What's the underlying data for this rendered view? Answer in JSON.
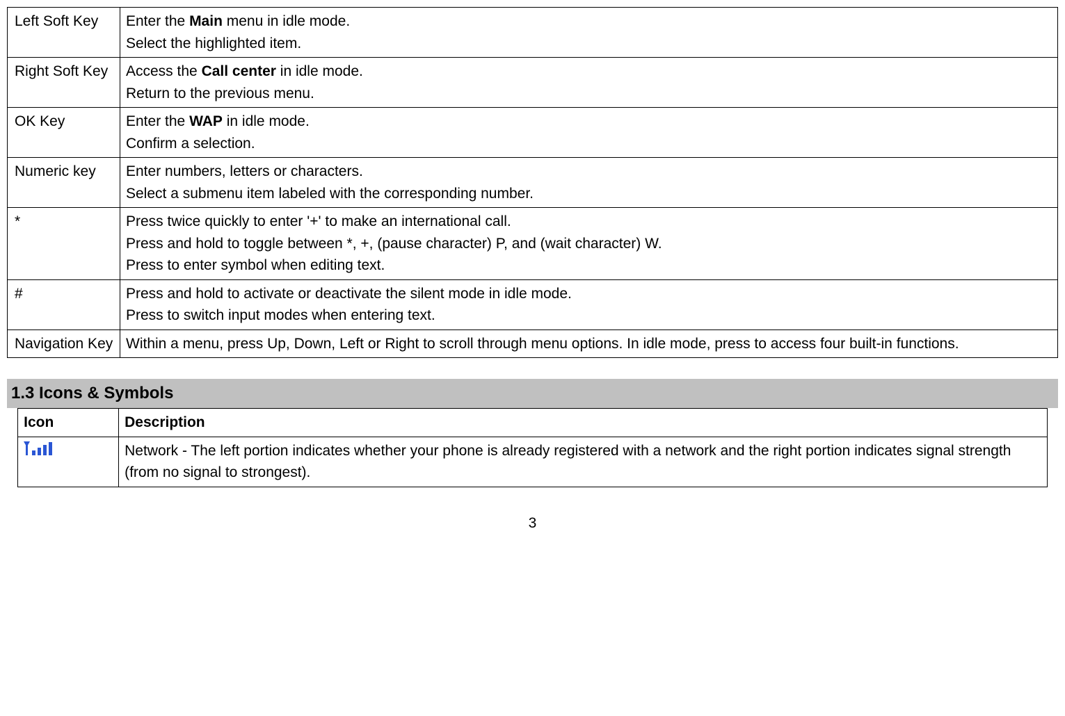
{
  "keys_table": {
    "rows": [
      {
        "key": "Left Soft Key",
        "desc_pre1": "Enter the ",
        "desc_bold1": "Main",
        "desc_post1": " menu in idle mode.",
        "desc_line2": "Select the highlighted item."
      },
      {
        "key": "Right Soft Key",
        "desc_pre1": "Access the ",
        "desc_bold1": "Call center",
        "desc_post1": " in idle mode.",
        "desc_line2": "Return to the previous menu."
      },
      {
        "key": "OK Key",
        "desc_pre1": "Enter the ",
        "desc_bold1": "WAP",
        "desc_post1": " in idle mode.",
        "desc_line2": "Confirm a selection."
      },
      {
        "key": "Numeric key",
        "desc_line1": "Enter numbers, letters or characters.",
        "desc_line2": "Select a submenu item labeled with the corresponding number."
      },
      {
        "key": "*",
        "desc_line1": "Press twice quickly to enter '+' to make an international call.",
        "desc_line2": "Press and hold to toggle between *, +, (pause character) P, and (wait character) W.",
        "desc_line3": "Press to enter symbol when editing text."
      },
      {
        "key": "#",
        "desc_line1": "Press and hold to activate or deactivate the silent mode in idle mode.",
        "desc_line2": "Press to switch input modes when entering text."
      },
      {
        "key": "Navigation Key",
        "desc_line1": "Within a menu, press Up, Down, Left or Right to scroll through menu options. In idle mode, press to access four built-in functions."
      }
    ]
  },
  "section_heading": "1.3 Icons & Symbols",
  "icons_table": {
    "header_icon": "Icon",
    "header_desc": "Description",
    "rows": [
      {
        "icon_name": "signal-icon",
        "desc": "Network - The left portion indicates whether your phone is already registered with a network and the right portion indicates signal strength (from no signal to strongest)."
      }
    ]
  },
  "page_number": "3"
}
